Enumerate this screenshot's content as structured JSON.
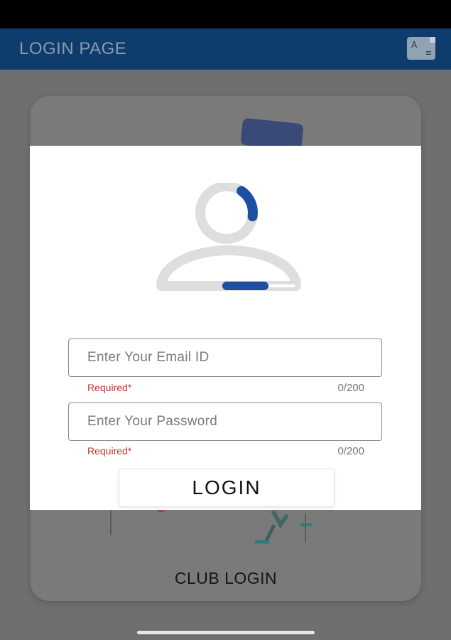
{
  "app_bar": {
    "title": "LOGIN PAGE",
    "translate_icon": "translate-icon"
  },
  "background": {
    "club_login_label": "CLUB LOGIN"
  },
  "dialog": {
    "avatar_icon": "user-avatar-icon",
    "email": {
      "placeholder": "Enter Your Email ID",
      "value": "",
      "required_text": "Required*",
      "counter": "0/200"
    },
    "password": {
      "placeholder": "Enter Your Password",
      "value": "",
      "required_text": "Required*",
      "counter": "0/200"
    },
    "login_label": "LOGIN"
  },
  "colors": {
    "app_bar": "#0e3c6c",
    "accent": "#1e4fa3",
    "required": "#d0312d",
    "overlay": "#6f6f6f"
  }
}
